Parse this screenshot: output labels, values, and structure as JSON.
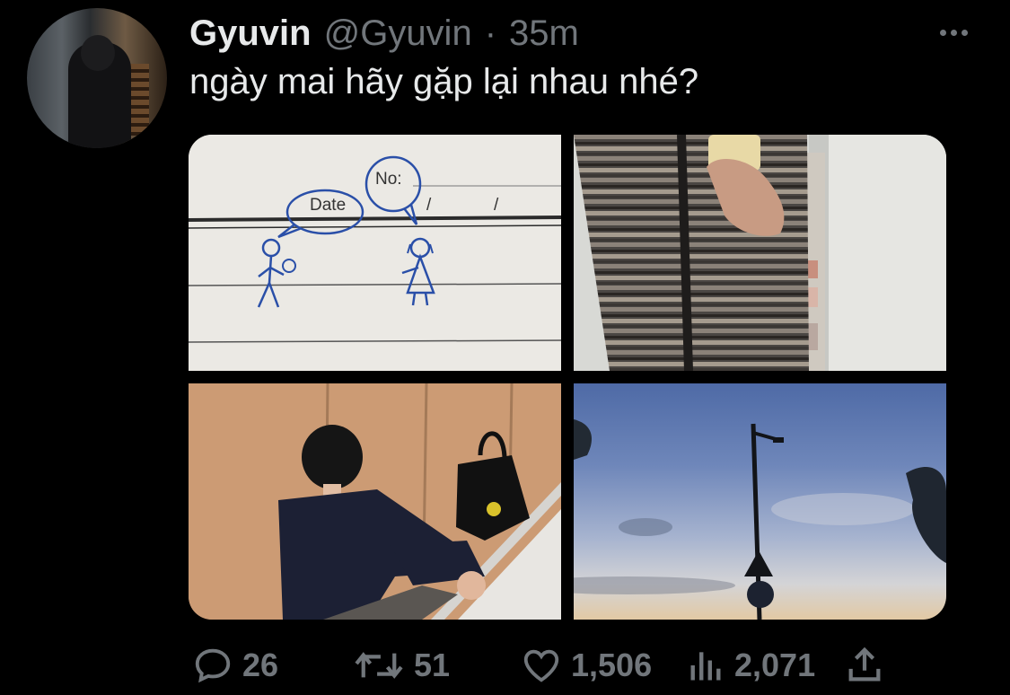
{
  "tweet": {
    "author_name": "Gyuvin",
    "author_handle": "@Gyuvin",
    "separator": "·",
    "time": "35m",
    "text": "ngày mai hãy gặp lại nhau nhé?"
  },
  "media": {
    "photo1": {
      "bubble_left_text": "Date",
      "bubble_right_text": "No:",
      "slash_1": "/",
      "slash_2": "/"
    }
  },
  "actions": {
    "replies": "26",
    "retweets": "51",
    "likes": "1,506",
    "views": "2,071"
  },
  "icons": {
    "reply": "speech-bubble-icon",
    "retweet": "retweet-arrows-icon",
    "like": "heart-icon",
    "views": "bar-chart-icon",
    "share": "share-upload-icon",
    "more": "more-dots-icon"
  },
  "colors": {
    "background": "#000000",
    "primary_text": "#e7e9ea",
    "secondary_text": "#71767b"
  }
}
